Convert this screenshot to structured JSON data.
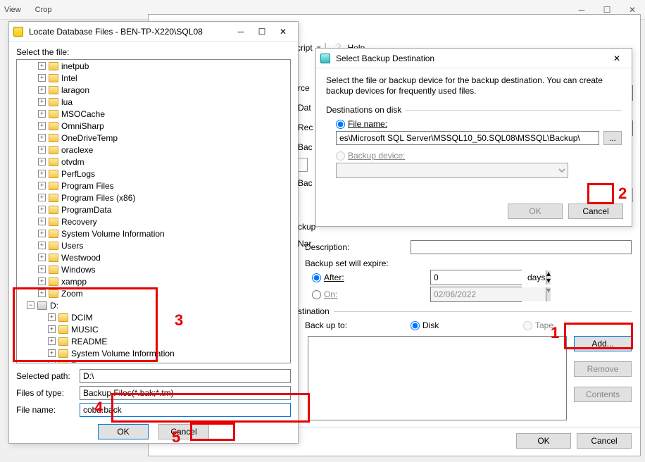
{
  "top": {
    "view": "View",
    "crop": "Crop"
  },
  "bg": {
    "helpMenu": "Help",
    "script": "cript",
    "descLabel": "Description:",
    "setExpire": "Backup set will expire:",
    "afterLabel": "After:",
    "afterVal": "0",
    "days": "days",
    "onLabel": "On:",
    "onDate": "02/06/2022",
    "destGroup": "stination",
    "backupTo": "Back up to:",
    "disk": "Disk",
    "tape": "Tape",
    "add": "Add...",
    "remove": "Remove",
    "contents": "Contents",
    "ok": "OK",
    "cancel": "Cancel",
    "sideLabels": [
      "rce",
      "Dat",
      "Rec",
      "Bac",
      "Bac",
      "ckup",
      "Nar"
    ]
  },
  "sbd": {
    "title": "Select Backup Destination",
    "intro": "Select the file or backup device for the backup destination. You can create backup devices for frequently used files.",
    "destDisk": "Destinations on disk",
    "fileName": "File name:",
    "path": "es\\Microsoft SQL Server\\MSSQL10_50.SQL08\\MSSQL\\Backup\\",
    "browse": "...",
    "backupDevice": "Backup device:",
    "ok": "OK",
    "cancel": "Cancel"
  },
  "ldf": {
    "title": "Locate Database Files - BEN-TP-X220\\SQL08",
    "selectFile": "Select the file:",
    "cFolders": [
      "inetpub",
      "Intel",
      "laragon",
      "lua",
      "MSOCache",
      "OmniSharp",
      "OneDriveTemp",
      "oraclexe",
      "otvdm",
      "PerfLogs",
      "Program Files",
      "Program Files (x86)",
      "ProgramData",
      "Recovery",
      "System Volume Information",
      "Users",
      "Westwood",
      "Windows",
      "xampp",
      "Zoom"
    ],
    "dDrive": "D:",
    "dFolders": [
      "DCIM",
      "MUSIC",
      "README",
      "System Volume Information",
      "Zoom"
    ],
    "selPathLbl": "Selected path:",
    "selPath": "D:\\",
    "filesTypeLbl": "Files of type:",
    "filesType": "Backup Files(*.bak;*.tm)",
    "fileNameLbl": "File name:",
    "fileName": "coba.back",
    "ok": "OK",
    "cancel": "Cancel"
  },
  "ann": {
    "n1": "1",
    "n2": "2",
    "n3": "3",
    "n4": "4",
    "n5": "5"
  }
}
